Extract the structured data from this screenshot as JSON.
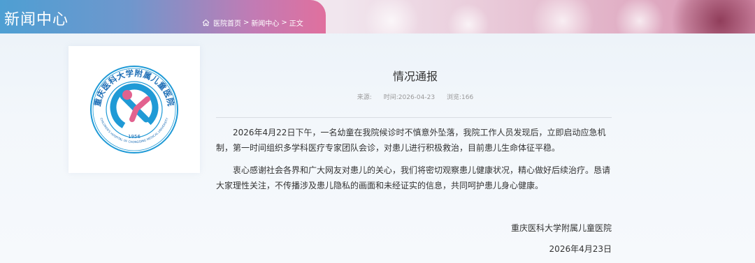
{
  "header": {
    "section_title": "新闻中心",
    "breadcrumb": {
      "icon": "home-icon",
      "items": [
        "医院首页",
        "新闻中心",
        "正文"
      ],
      "separator": ">"
    }
  },
  "logo": {
    "text_top": "重庆医科大学附属儿童医院",
    "text_bottom": "CHILDREN'S HOSPITAL OF CHONGQING MEDICAL UNIVERSITY",
    "year": "1956",
    "colors": {
      "blue": "#1f9ad6",
      "pink": "#e2628f"
    }
  },
  "article": {
    "title": "情况通报",
    "meta": {
      "source_label": "来源:",
      "source_value": "",
      "time_label": "时间:",
      "time_value": "2026-04-23",
      "views_label": "浏览:",
      "views_value": "166"
    },
    "paragraphs": [
      "2026年4月22日下午，一名幼童在我院候诊时不慎意外坠落，我院工作人员发现后，立即启动应急机制，第一时间组织多学科医疗专家团队会诊，对患儿进行积极救治，目前患儿生命体征平稳。",
      "衷心感谢社会各界和广大网友对患儿的关心，我们将密切观察患儿健康状况，精心做好后续治疗。恳请大家理性关注，不传播涉及患儿隐私的画面和未经证实的信息，共同呵护患儿身心健康。"
    ],
    "signature": "重庆医科大学附属儿童医院",
    "date": "2026年4月23日"
  }
}
